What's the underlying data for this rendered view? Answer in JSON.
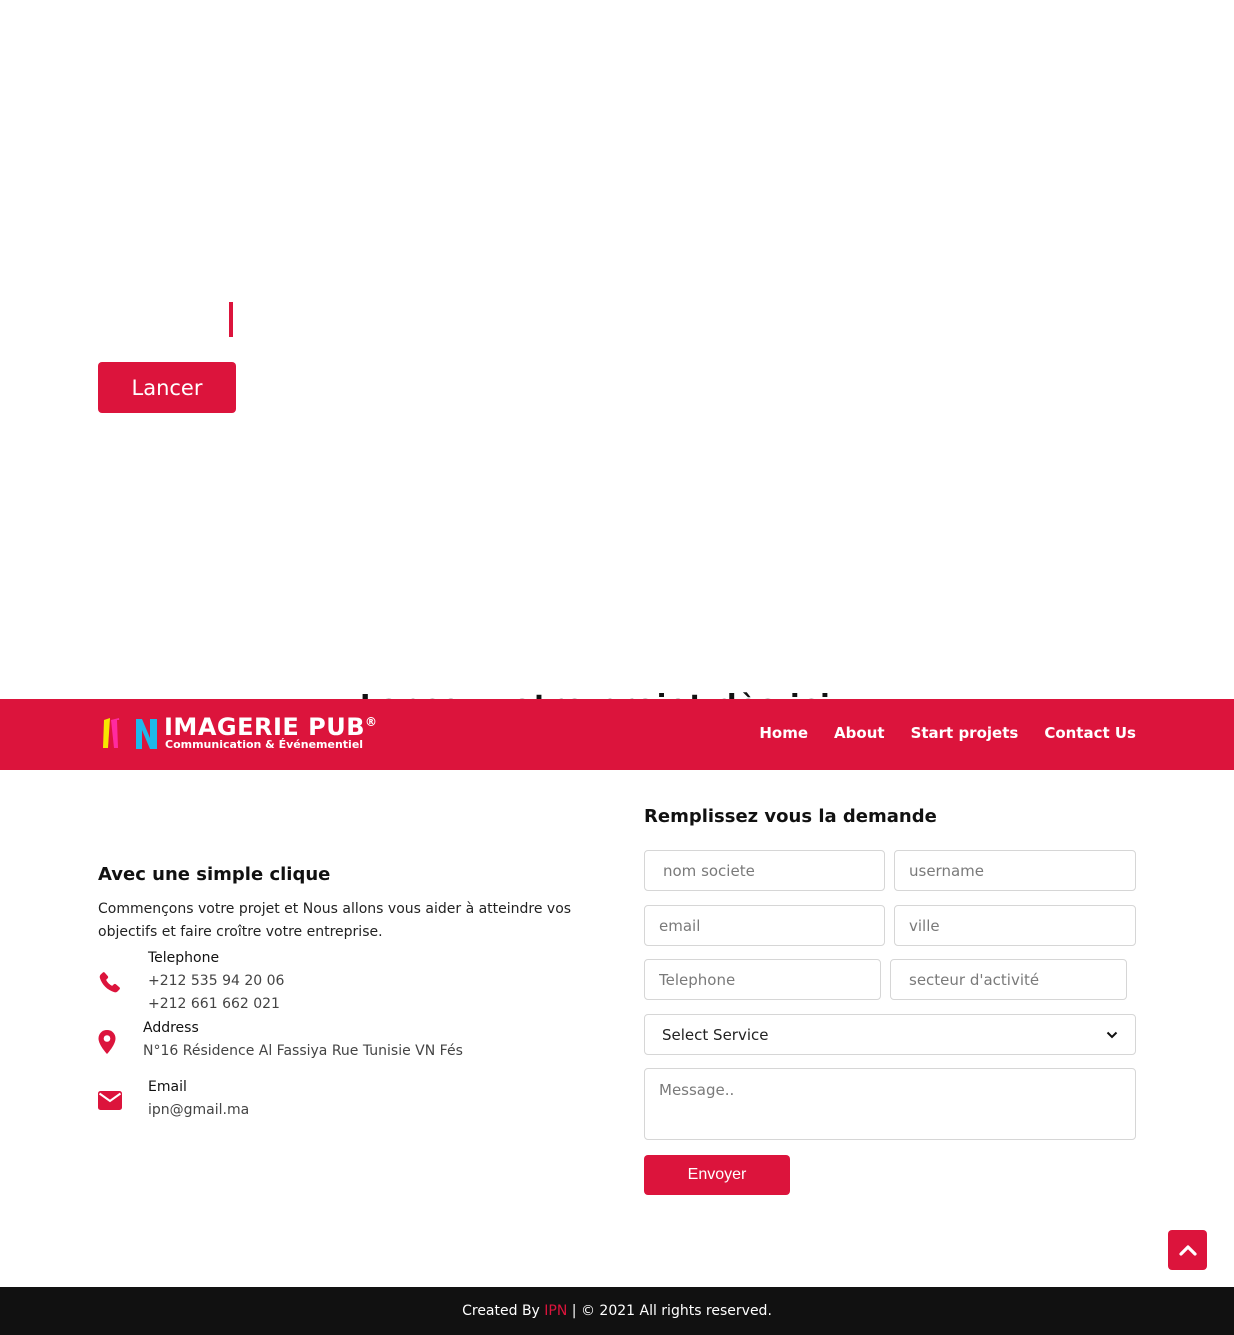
{
  "hero": {
    "launch_label": "Lancer",
    "peek_text": "Lancez votre projet dès ici"
  },
  "navbar": {
    "logo_title": "IMAGERIE PUB",
    "logo_reg": "®",
    "logo_subtitle": "Communication & Événementiel",
    "links": [
      "Home",
      "About",
      "Start projets",
      "Contact Us"
    ]
  },
  "contact": {
    "title": "Avec une simple clique",
    "description": "Commençons votre projet et Nous allons vous aider à atteindre vos objectifs et faire croître votre entreprise.",
    "telephone_label": "Telephone",
    "phone_1": "+212 535 94 20 06",
    "phone_2": "+212 661 662 021",
    "address_label": "Address",
    "address_value": "N°16 Résidence Al Fassiya Rue Tunisie VN Fés",
    "email_label": "Email",
    "email_value": "ipn@gmail.ma"
  },
  "form": {
    "title": "Remplissez vous la demande",
    "placeholders": {
      "company": "nom societe",
      "username": "username",
      "email": "email",
      "city": "ville",
      "telephone": "Telephone",
      "sector": "secteur d'activité",
      "message": "Message.."
    },
    "select_value": "Select Service",
    "submit_label": "Envoyer"
  },
  "footer": {
    "prefix": "Created By ",
    "brand": "IPN",
    "suffix": " | © 2021 All rights reserved."
  },
  "colors": {
    "accent": "#dc143c",
    "footer_bg": "#111111"
  },
  "icons": {
    "phone": "phone-icon",
    "address": "map-marker-icon",
    "email": "envelope-icon",
    "scroll_top": "chevron-up-icon",
    "select": "chevron-down-icon"
  }
}
